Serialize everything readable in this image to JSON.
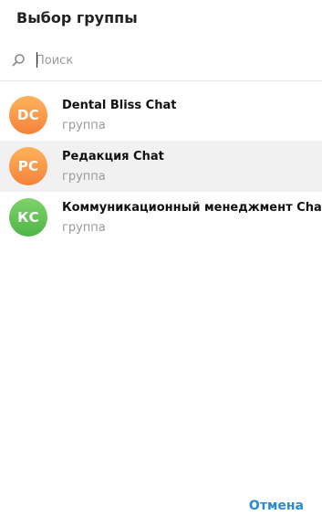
{
  "dialog": {
    "title": "Выбор группы"
  },
  "search": {
    "placeholder": "Поиск",
    "value": "",
    "icon": "search-icon"
  },
  "groups": [
    {
      "initials": "DC",
      "name": "Dental Bliss Chat",
      "subtitle": "группа",
      "avatar_color": "#f58d3f",
      "selected": false
    },
    {
      "initials": "РС",
      "name": "Редакция Chat",
      "subtitle": "группа",
      "avatar_color": "#f58d3f",
      "selected": true
    },
    {
      "initials": "КС",
      "name": "Коммуникационный менеджмент Chat",
      "subtitle": "группа",
      "avatar_color": "#56bb4c",
      "selected": false
    }
  ],
  "footer": {
    "cancel_label": "Отмена"
  },
  "colors": {
    "accent": "#2a8bd0",
    "selected_row": "#f1f1f1",
    "subtitle": "#9a9a9a"
  }
}
